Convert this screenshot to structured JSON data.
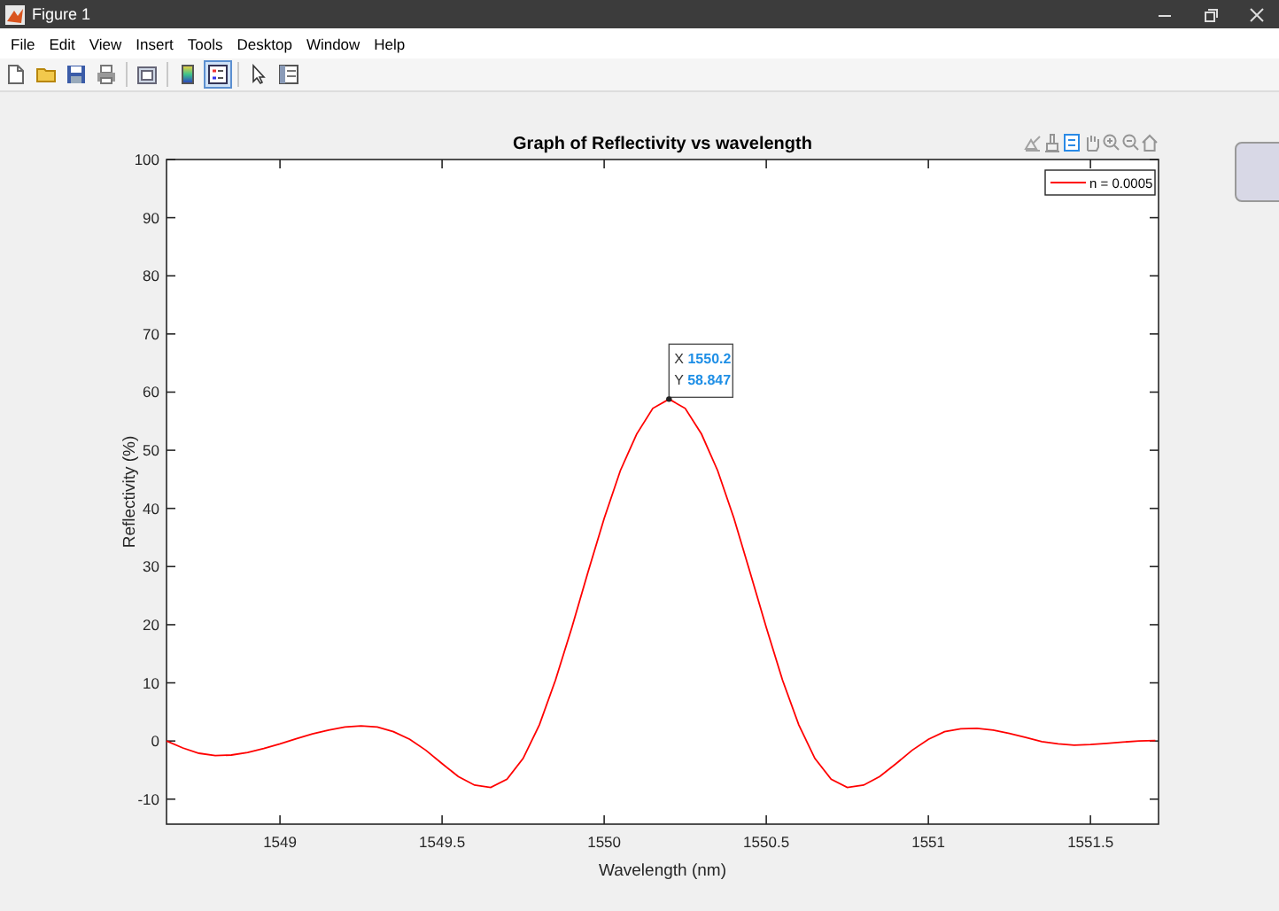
{
  "window": {
    "title": "Figure 1"
  },
  "menu": [
    "File",
    "Edit",
    "View",
    "Insert",
    "Tools",
    "Desktop",
    "Window",
    "Help"
  ],
  "toolbar": [
    {
      "kind": "new",
      "pressed": false
    },
    {
      "kind": "open",
      "pressed": false
    },
    {
      "kind": "save",
      "pressed": false
    },
    {
      "kind": "print",
      "pressed": false
    },
    {
      "kind": "separator"
    },
    {
      "kind": "link",
      "pressed": false
    },
    {
      "kind": "separator"
    },
    {
      "kind": "colorbar",
      "pressed": false
    },
    {
      "kind": "legend",
      "pressed": true
    },
    {
      "kind": "separator"
    },
    {
      "kind": "pointer",
      "pressed": false
    },
    {
      "kind": "inspector",
      "pressed": false
    }
  ],
  "axes_toolbar": [
    {
      "kind": "export",
      "selected": false
    },
    {
      "kind": "brush",
      "selected": false
    },
    {
      "kind": "datatip",
      "selected": true
    },
    {
      "kind": "pan",
      "selected": false
    },
    {
      "kind": "zoomin",
      "selected": false
    },
    {
      "kind": "zoomout",
      "selected": false
    },
    {
      "kind": "home",
      "selected": false
    }
  ],
  "axes": {
    "chart_data": {
      "type": "line",
      "title": "Graph of Reflectivity vs wavelength",
      "xlabel": "Wavelength (nm)",
      "ylabel": "Reflectivity (%)",
      "x": [
        1548.65,
        1548.7,
        1548.75,
        1548.8,
        1548.85,
        1548.9,
        1548.95,
        1549,
        1549.05,
        1549.1,
        1549.15,
        1549.2,
        1549.25,
        1549.3,
        1549.35,
        1549.4,
        1549.45,
        1549.5,
        1549.55,
        1549.6,
        1549.65,
        1549.7,
        1549.75,
        1549.8,
        1549.85,
        1549.9,
        1549.95,
        1550,
        1550.05,
        1550.1,
        1550.15,
        1550.2,
        1550.25,
        1550.3,
        1550.35,
        1550.4,
        1550.45,
        1550.5,
        1550.55,
        1550.6,
        1550.65,
        1550.7,
        1550.75,
        1550.8,
        1550.85,
        1550.9,
        1550.95,
        1551,
        1551.05,
        1551.1,
        1551.15,
        1551.2,
        1551.25,
        1551.3,
        1551.35,
        1551.4,
        1551.45,
        1551.5,
        1551.55,
        1551.6,
        1551.65,
        1551.7
      ],
      "series": [
        {
          "name": "n = 0.0005",
          "color": "#ff0000",
          "values": [
            0,
            -1.2,
            -2.1,
            -2.5,
            -2.4,
            -2.0,
            -1.3,
            -0.5,
            0.4,
            1.2,
            1.9,
            2.4,
            2.6,
            2.4,
            1.6,
            0.3,
            -1.6,
            -3.9,
            -6.1,
            -7.6,
            -8.0,
            -6.6,
            -3.0,
            2.8,
            10.5,
            19.5,
            29.0,
            38.3,
            46.5,
            52.8,
            57.2,
            58.8,
            57.2,
            52.8,
            46.5,
            38.3,
            29.0,
            19.5,
            10.5,
            2.8,
            -3.0,
            -6.6,
            -8.0,
            -7.6,
            -6.1,
            -3.9,
            -1.6,
            0.3,
            1.6,
            2.1,
            2.2,
            1.9,
            1.3,
            0.6,
            -0.1,
            -0.5,
            -0.7,
            -0.6,
            -0.4,
            -0.2,
            0.0,
            0.1
          ]
        }
      ],
      "xlim": [
        1548.65,
        1551.71
      ],
      "ylim": [
        -14.3,
        100
      ],
      "xticks": [
        1549,
        1549.5,
        1550,
        1550.5,
        1551,
        1551.5
      ],
      "yticks": [
        -10,
        0,
        10,
        20,
        30,
        40,
        50,
        60,
        70,
        80,
        90,
        100
      ]
    },
    "datatip": {
      "x_label": "X",
      "x_value": "1550.2",
      "y_label": "Y",
      "y_value": "58.847"
    }
  }
}
